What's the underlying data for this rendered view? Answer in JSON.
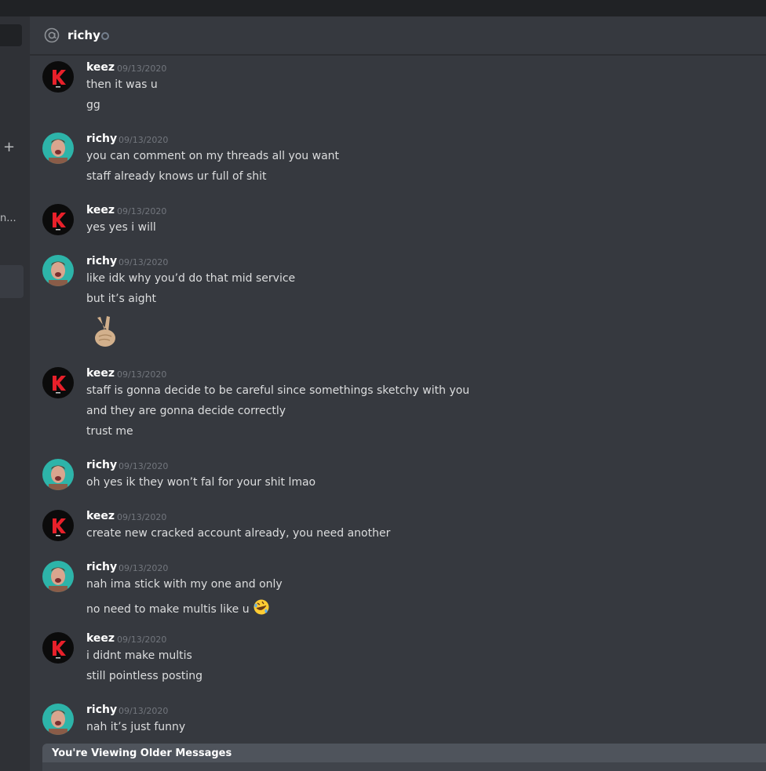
{
  "header": {
    "title": "richy",
    "at_icon": "at-icon",
    "status": "offline"
  },
  "sidebar": {
    "plus_label": "+",
    "truncated_label": "n..."
  },
  "messages": [
    {
      "author": "keez",
      "avatar": "keez-avatar",
      "timestamp": "09/13/2020",
      "lines": [
        "then it was u",
        "gg"
      ]
    },
    {
      "author": "richy",
      "avatar": "richy-avatar",
      "timestamp": "09/13/2020",
      "lines": [
        "you can comment on my threads all you want",
        "staff already knows ur full of shit"
      ]
    },
    {
      "author": "keez",
      "avatar": "keez-avatar",
      "timestamp": "09/13/2020",
      "lines": [
        "yes yes i will"
      ]
    },
    {
      "author": "richy",
      "avatar": "richy-avatar",
      "timestamp": "09/13/2020",
      "lines": [
        "like idk why you’d do that mid service",
        "but it’s aight"
      ],
      "emoji": "victory-hand-emoji"
    },
    {
      "author": "keez",
      "avatar": "keez-avatar",
      "timestamp": "09/13/2020",
      "lines": [
        "staff is gonna decide to be careful since somethings sketchy with you",
        "and they are gonna decide correctly",
        "trust me"
      ]
    },
    {
      "author": "richy",
      "avatar": "richy-avatar",
      "timestamp": "09/13/2020",
      "lines": [
        "oh yes ik they won’t fal for your shit lmao"
      ]
    },
    {
      "author": "keez",
      "avatar": "keez-avatar",
      "timestamp": "09/13/2020",
      "lines": [
        "create new cracked account already, you need another"
      ]
    },
    {
      "author": "richy",
      "avatar": "richy-avatar",
      "timestamp": "09/13/2020",
      "lines": [
        "nah ima stick with my one and only",
        "no need to make multis like u"
      ],
      "inline_emoji": "rofl-emoji"
    },
    {
      "author": "keez",
      "avatar": "keez-avatar",
      "timestamp": "09/13/2020",
      "lines": [
        "i didnt make multis",
        "still pointless posting"
      ]
    },
    {
      "author": "richy",
      "avatar": "richy-avatar",
      "timestamp": "09/13/2020",
      "lines": [
        "nah it’s just funny"
      ]
    }
  ],
  "older_banner": {
    "text": "You're Viewing Older Messages"
  },
  "colors": {
    "background": "#36393f",
    "sidebar": "#2f3136",
    "titlebar": "#202225",
    "username": "#ffffff",
    "timestamp": "#72767d",
    "keez_avatar_red": "#e8202a",
    "richy_avatar_teal": "#2db4a9",
    "older_banner": "#4f545c"
  }
}
